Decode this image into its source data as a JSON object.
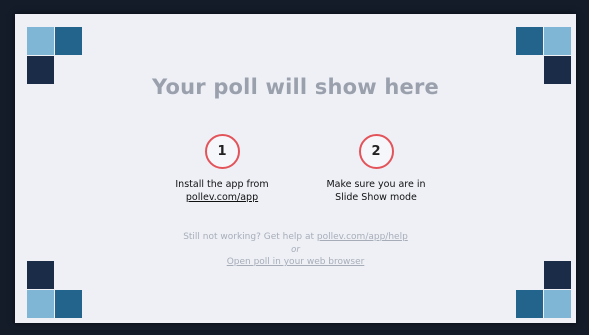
{
  "slide": {
    "title": "Your poll will show here",
    "steps": [
      {
        "number": "1",
        "line1": "Install the app from",
        "link": "pollev.com/app"
      },
      {
        "number": "2",
        "line1": "Make sure you are in",
        "line2": "Slide Show mode"
      }
    ],
    "help_prefix": "Still not working? Get help at ",
    "help_link": "pollev.com/app/help",
    "or_text": "or",
    "browser_link": "Open poll in your web browser"
  },
  "colors": {
    "background": "#eef0f6",
    "accent_red": "#e3545a",
    "tile_light": "#7fb6d6",
    "tile_mid": "#23648c",
    "tile_dark": "#1b2c48"
  }
}
